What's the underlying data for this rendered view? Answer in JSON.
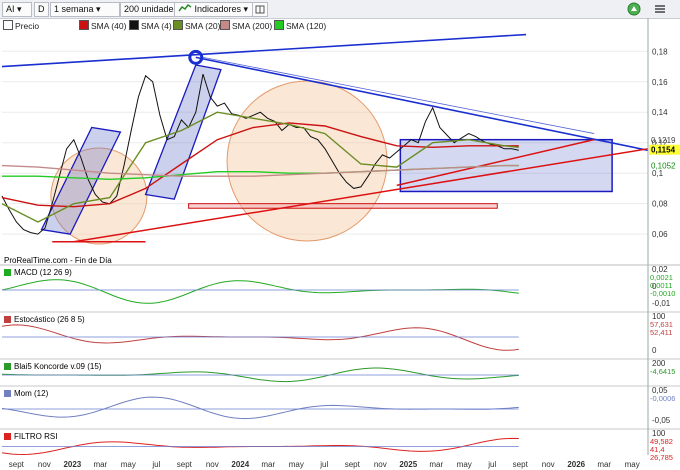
{
  "toolbar": {
    "symbol": "AI",
    "d_label": "D",
    "period": "1 semana",
    "units": "200 unidades",
    "indicators": "Indicadores",
    "indicators_icon": "indicators-chart-icon",
    "config_icon": "layout-settings-icon",
    "alert_icon": "alert-bell-icon",
    "menu_icon": "hamburger-menu-icon"
  },
  "legend": [
    {
      "label": "Precio",
      "color": "#ffffff"
    },
    {
      "label": "SMA (40)",
      "color": "#cc1111"
    },
    {
      "label": "SMA (4)",
      "color": "#111111"
    },
    {
      "label": "SMA (20)",
      "color": "#6b8e23"
    },
    {
      "label": "SMA (200)",
      "color": "#c48a8a"
    },
    {
      "label": "SMA (120)",
      "color": "#22cc22"
    }
  ],
  "watermark": "ProRealTime.com - Fin de Día",
  "chart_data": {
    "type": "line",
    "x_tick_labels": [
      "sept",
      "nov",
      "2023",
      "mar",
      "may",
      "jul",
      "sept",
      "nov",
      "2024",
      "mar",
      "may",
      "jul",
      "sept",
      "nov",
      "2025",
      "mar",
      "may",
      "jul",
      "sept",
      "nov",
      "2026",
      "mar",
      "may"
    ],
    "ylim": [
      0.045,
      0.192
    ],
    "y_ticks": [
      0.06,
      0.08,
      0.1,
      0.12,
      0.14,
      0.16,
      0.18
    ],
    "y_tick_labels": [
      "0,06",
      "0,08",
      "0,1",
      "0,12",
      "0,14",
      "0,16",
      "0,18"
    ],
    "price_labels": [
      {
        "text": "0,1219",
        "value": 0.1219,
        "color": "#444444"
      },
      {
        "text": "0,1154",
        "value": 0.1154,
        "color": "#000000",
        "bg": "#ffff33"
      },
      {
        "text": "0,1052",
        "value": 0.1052,
        "color": "#118811"
      }
    ],
    "series": [
      {
        "name": "Precio",
        "color": "#111111",
        "x": [
          0,
          2,
          4,
          6,
          8,
          10,
          12,
          14,
          16,
          18,
          20,
          22,
          24,
          26,
          28,
          30,
          32,
          34,
          36,
          38,
          40,
          42,
          44,
          46,
          48,
          50,
          52,
          54,
          56,
          58,
          60,
          62,
          64,
          66,
          68,
          70,
          72,
          74,
          76,
          78,
          80,
          82,
          84,
          86,
          88,
          90,
          92,
          94,
          96,
          98,
          100,
          102,
          104,
          106,
          108,
          110,
          112,
          114,
          116,
          118,
          120,
          122,
          124,
          126,
          128,
          130,
          132,
          134,
          136,
          138,
          140,
          142,
          144
        ],
        "y": [
          0.085,
          0.076,
          0.068,
          0.063,
          0.061,
          0.06,
          0.064,
          0.08,
          0.098,
          0.116,
          0.122,
          0.11,
          0.096,
          0.086,
          0.081,
          0.08,
          0.085,
          0.105,
          0.128,
          0.15,
          0.164,
          0.16,
          0.138,
          0.122,
          0.124,
          0.135,
          0.13,
          0.14,
          0.165,
          0.15,
          0.144,
          0.146,
          0.139,
          0.138,
          0.136,
          0.138,
          0.14,
          0.136,
          0.134,
          0.128,
          0.132,
          0.13,
          0.13,
          0.124,
          0.122,
          0.116,
          0.108,
          0.1,
          0.094,
          0.09,
          0.091,
          0.098,
          0.106,
          0.112,
          0.11,
          0.114,
          0.118,
          0.122,
          0.12,
          0.134,
          0.143,
          0.13,
          0.125,
          0.12,
          0.123,
          0.126,
          0.124,
          0.121,
          0.119,
          0.118,
          0.116,
          0.116,
          0.115
        ]
      },
      {
        "name": "SMA (40)",
        "color": "#cc1111",
        "x": [
          0,
          10,
          20,
          30,
          40,
          50,
          60,
          70,
          80,
          90,
          100,
          110,
          120,
          130,
          140,
          144
        ],
        "y": [
          0.084,
          0.079,
          0.078,
          0.08,
          0.09,
          0.106,
          0.122,
          0.13,
          0.133,
          0.131,
          0.124,
          0.118,
          0.117,
          0.118,
          0.118,
          0.118
        ]
      },
      {
        "name": "SMA (20)",
        "color": "#6b8e23",
        "x": [
          0,
          10,
          20,
          30,
          40,
          50,
          60,
          70,
          80,
          90,
          100,
          110,
          120,
          130,
          140,
          144
        ],
        "y": [
          0.08,
          0.068,
          0.08,
          0.084,
          0.12,
          0.128,
          0.14,
          0.136,
          0.132,
          0.126,
          0.106,
          0.104,
          0.12,
          0.122,
          0.118,
          0.117
        ]
      },
      {
        "name": "SMA (120)",
        "color": "#22cc22",
        "x": [
          0,
          10,
          20,
          30,
          40,
          50,
          60,
          70,
          80,
          90,
          100,
          110,
          120,
          130,
          140,
          144
        ],
        "y": [
          0.098,
          0.098,
          0.097,
          0.096,
          0.097,
          0.099,
          0.101,
          0.101,
          0.1,
          0.1,
          0.101,
          0.102,
          0.103,
          0.104,
          0.105,
          0.105
        ]
      },
      {
        "name": "SMA (200)",
        "color": "#c48a8a",
        "x": [
          0,
          10,
          20,
          30,
          40,
          50,
          60,
          70,
          80,
          90,
          100,
          110,
          120,
          130,
          140,
          144
        ],
        "y": [
          0.105,
          0.104,
          0.102,
          0.1,
          0.099,
          0.098,
          0.098,
          0.098,
          0.099,
          0.1,
          0.101,
          0.102,
          0.103,
          0.104,
          0.105,
          0.105
        ]
      }
    ],
    "panels": [
      {
        "title": "MACD (12 26 9)",
        "axis": [
          "0,02",
          "0",
          "-0,01"
        ],
        "values": [
          "0,0021",
          "0,0011",
          "-0,0010"
        ]
      },
      {
        "title": "Estocástico (26 8 5)",
        "axis": [
          "100",
          "0"
        ],
        "values": [
          "57,631",
          "52,411"
        ]
      },
      {
        "title": "Blai5 Koncorde v.09 (15)",
        "axis": [
          "200"
        ],
        "values": [
          "-4,6415"
        ]
      },
      {
        "title": "Mom (12)",
        "axis": [
          "0,05",
          "-0,05"
        ],
        "values": [
          "-0,0006"
        ]
      },
      {
        "title": "FILTRO RSI",
        "axis": [
          "100"
        ],
        "values": [
          "49,582",
          "41,4",
          "26,785"
        ]
      }
    ]
  }
}
